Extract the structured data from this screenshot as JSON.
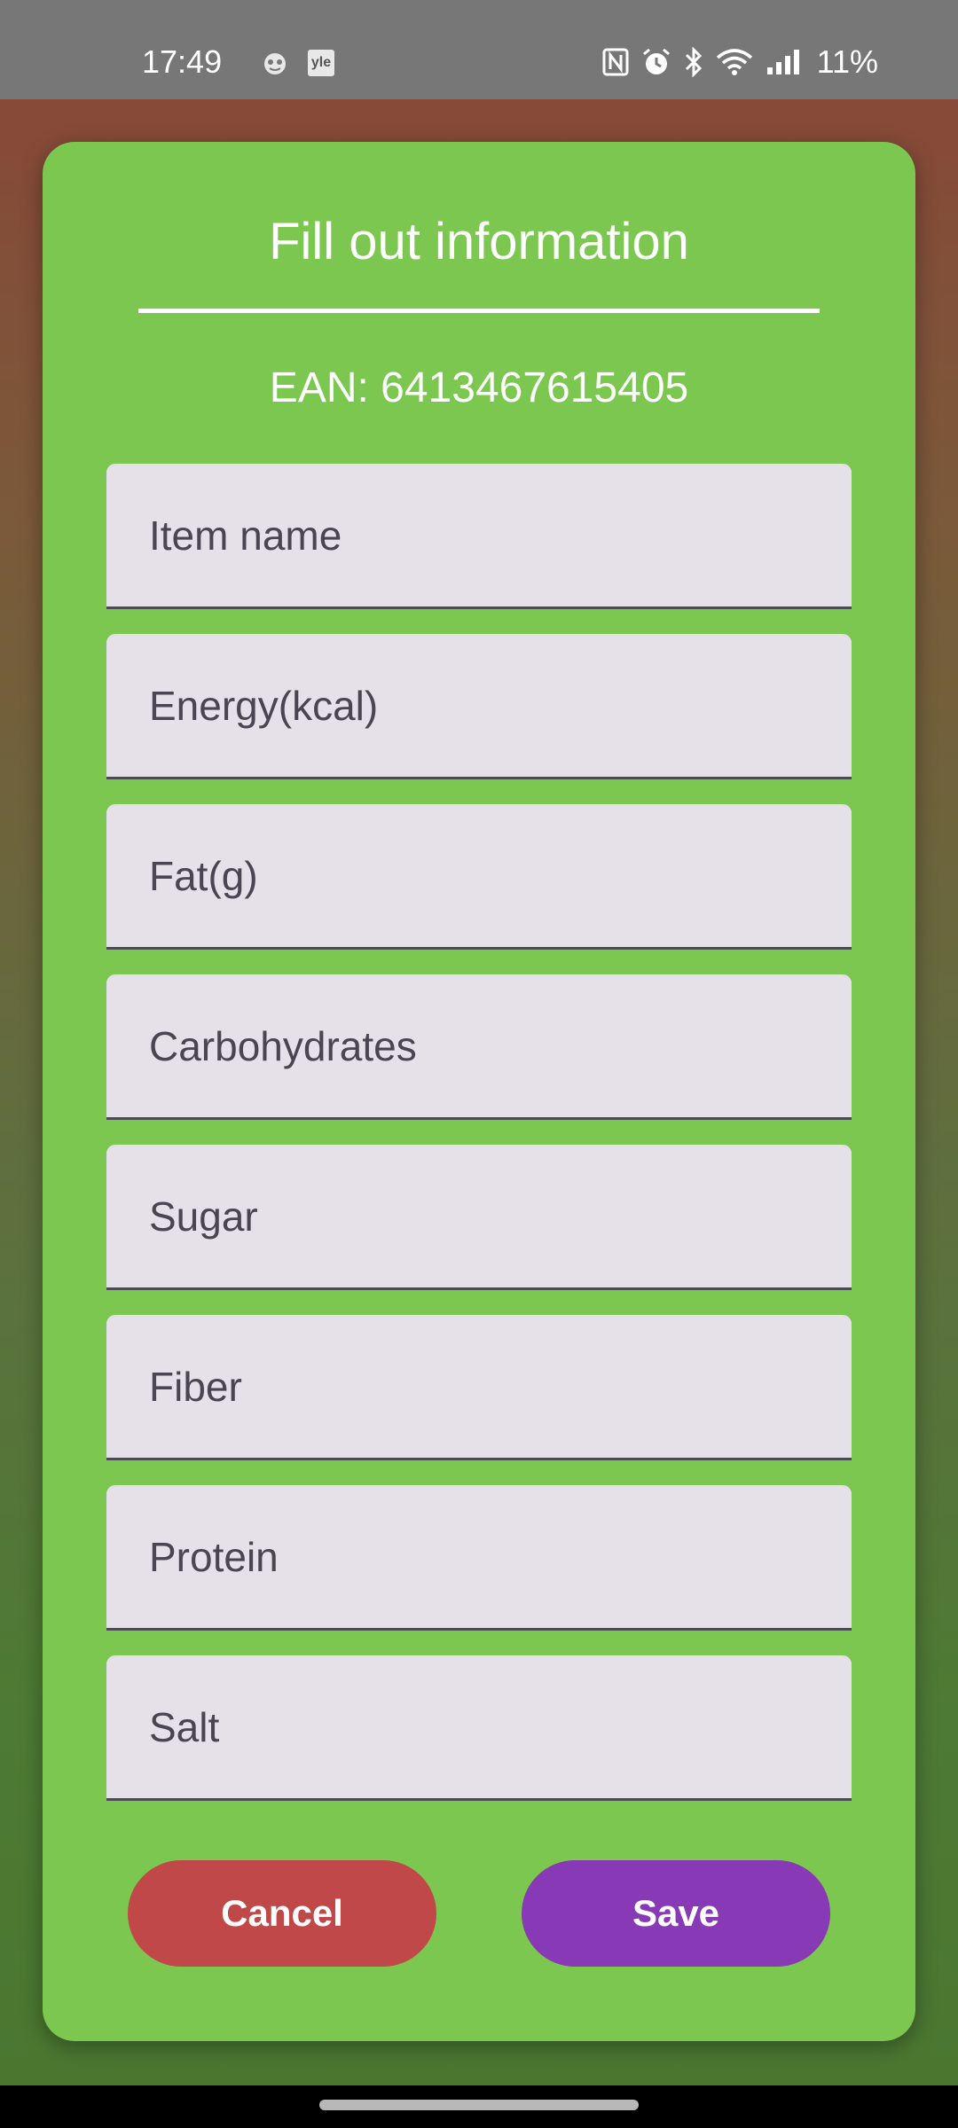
{
  "status_bar": {
    "time": "17:49",
    "notification_icons": [
      "cat-face-icon",
      "yle-app-icon"
    ],
    "yle_text": "yle",
    "system_icons": [
      "nfc-icon",
      "alarm-icon",
      "bluetooth-icon",
      "wifi-icon",
      "cellular-signal-icon"
    ],
    "battery": "11%"
  },
  "dialog": {
    "title": "Fill out information",
    "ean": "EAN: 6413467615405",
    "fields": [
      {
        "placeholder": "Item name"
      },
      {
        "placeholder": "Energy(kcal)"
      },
      {
        "placeholder": "Fat(g)"
      },
      {
        "placeholder": "Carbohydrates"
      },
      {
        "placeholder": "Sugar"
      },
      {
        "placeholder": "Fiber"
      },
      {
        "placeholder": "Protein"
      },
      {
        "placeholder": "Salt"
      }
    ],
    "cancel_label": "Cancel",
    "save_label": "Save"
  },
  "colors": {
    "dialog_background": "#7bc74f",
    "cancel_button": "#c04848",
    "save_button": "#8839b5",
    "field_background": "#e6e0e8"
  }
}
